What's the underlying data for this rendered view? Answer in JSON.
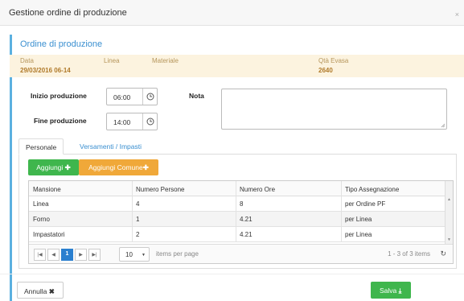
{
  "modal": {
    "title": "Gestione ordine di produzione",
    "close_icon": "×"
  },
  "panel": {
    "title": "Ordine di produzione"
  },
  "info": {
    "labels": {
      "data": "Data",
      "linea": "Linea",
      "materiale": "Materiale",
      "qta_evasa": "Qtà Evasa"
    },
    "values": {
      "data": "29/03/2016 06-14",
      "linea": "",
      "materiale": "",
      "qta_evasa": "2640"
    }
  },
  "form": {
    "inizio_label": "Inizio produzione",
    "inizio_value": "06:00",
    "fine_label": "Fine produzione",
    "fine_value": "14:00",
    "nota_label": "Nota",
    "nota_value": ""
  },
  "tabs": [
    {
      "label": "Personale",
      "active": true
    },
    {
      "label": "Versamenti / Impasti",
      "active": false
    }
  ],
  "toolbar": {
    "add_label": "Aggiungi",
    "add_common_label": "Aggiungi Comune"
  },
  "grid": {
    "columns": [
      "Mansione",
      "Numero Persone",
      "Numero Ore",
      "Tipo Assegnazione"
    ],
    "rows": [
      [
        "Linea",
        "4",
        "8",
        "per Ordine PF"
      ],
      [
        "Forno",
        "1",
        "4.21",
        "per Linea"
      ],
      [
        "Impastatori",
        "2",
        "4.21",
        "per Linea"
      ]
    ]
  },
  "pager": {
    "current_page": "1",
    "page_size": "10",
    "items_per_page_label": "items per page",
    "info": "1 - 3 of 3 items"
  },
  "footer": {
    "cancel_label": "Annulla",
    "save_label": "Salva"
  },
  "colors": {
    "accent": "#3a8fd0",
    "green": "#3fb64d",
    "orange": "#f0a839",
    "info_bg": "#fcf3df"
  }
}
